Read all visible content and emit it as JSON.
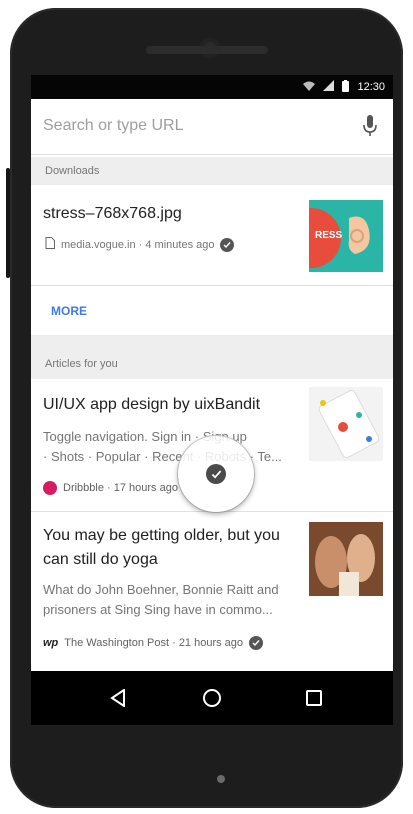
{
  "status": {
    "time": "12:30"
  },
  "search": {
    "placeholder": "Search or type URL"
  },
  "downloads": {
    "header": "Downloads",
    "item": {
      "title": "stress–768x768.jpg",
      "meta": "media.vogue.in · 4 minutes ago",
      "thumb_text": "RESS"
    },
    "more_label": "MORE"
  },
  "articles": {
    "header": "Articles for you",
    "items": [
      {
        "title": "UI/UX app design by uixBandit",
        "snippet1": "Toggle navigation. Sign in · Sign up",
        "snippet2": "· Shots · Popular · Recent · Robots · Te...",
        "meta": "Dribbble · 17 hours ago",
        "source_color": "#d81b60"
      },
      {
        "title1": "You may be getting older, but you",
        "title2": "can still do yoga",
        "snippet1": "What do John Boehner, Bonnie Raitt and",
        "snippet2": "prisoners at Sing Sing have in commo...",
        "meta": "The Washington Post · 21 hours ago",
        "source_logo": "wp"
      }
    ]
  },
  "colors": {
    "accent": "#3d7de0",
    "thumb_teal": "#2bb5a6",
    "thumb_red": "#e74c3c"
  }
}
